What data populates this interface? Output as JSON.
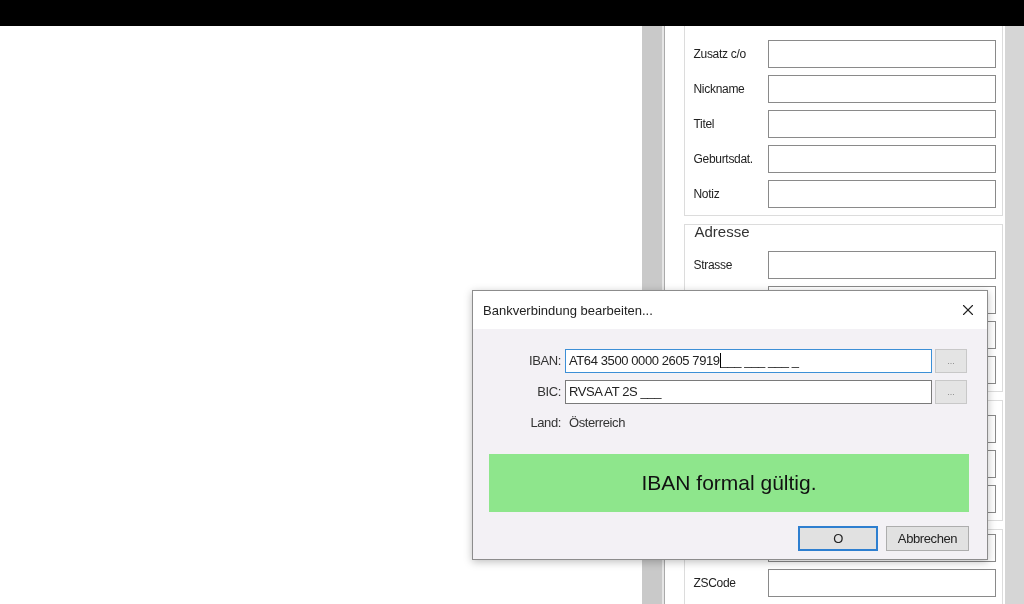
{
  "form": {
    "sections": [
      {
        "fields": [
          {
            "label": "Zusatz c/o"
          },
          {
            "label": "Nickname"
          },
          {
            "label": "Titel"
          },
          {
            "label": "Geburtsdat."
          },
          {
            "label": "Notiz"
          }
        ]
      },
      {
        "title": "Adresse",
        "fields": [
          {
            "label": "Strasse"
          }
        ]
      },
      {
        "fields": [
          {
            "label": "ZSCode"
          }
        ]
      }
    ]
  },
  "dialog": {
    "title": "Bankverbindung bearbeiten...",
    "fields": [
      {
        "label": "IBAN:",
        "value": "AT64 3500 0000 2605 7919",
        "mask": "___ ___ ___ _",
        "focused": true,
        "button": "..."
      },
      {
        "label": "BIC:",
        "value": "RVSA AT 2S ",
        "mask": "___",
        "focused": false,
        "button": "..."
      }
    ],
    "country": {
      "label": "Land:",
      "value": "Österreich"
    },
    "status": {
      "text": "IBAN formal gültig.",
      "valid": true
    },
    "buttons": [
      {
        "label": "O",
        "default": true
      },
      {
        "label": "Abbrechen",
        "default": false
      }
    ]
  }
}
